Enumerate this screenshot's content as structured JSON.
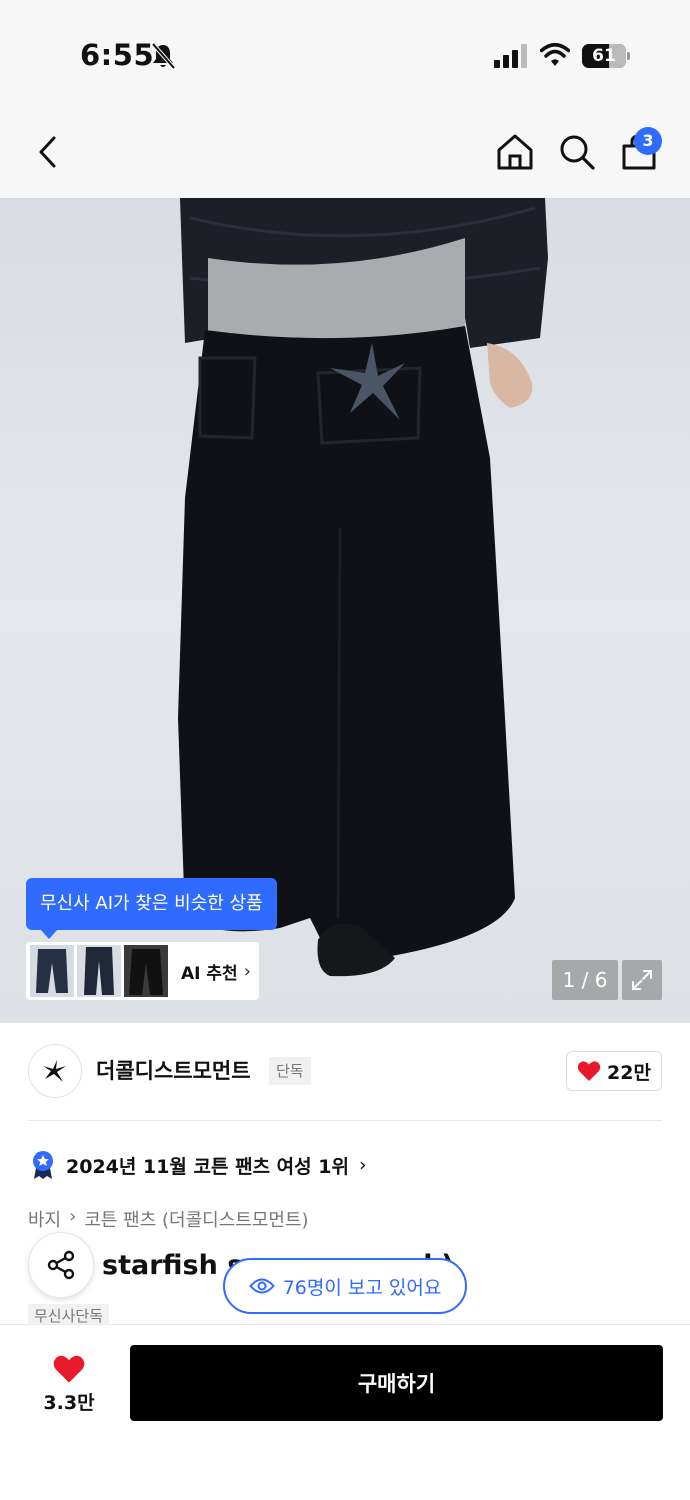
{
  "status_bar": {
    "time": "6:55",
    "battery": "61",
    "battery_level": 0.61
  },
  "nav": {
    "cart_count": "3"
  },
  "gallery": {
    "ai_tooltip": "무신사 AI가 찾은 비슷한 상품",
    "ai_label": "AI 추천",
    "page_indicator": "1 / 6"
  },
  "brand": {
    "name": "더콜디스트모먼트",
    "tag": "단독",
    "likes": "22만"
  },
  "ranking": {
    "text": "2024년 11월 코튼 팬츠 여성 1위"
  },
  "breadcrumb": {
    "category": "바지",
    "subcategory": "코튼 팬츠 (더콜디스트모먼트)"
  },
  "product": {
    "title": "starfish s",
    "title_end": "k)",
    "viewers": "76명이 보고 있어요",
    "exclusive_tag": "무신사단독"
  },
  "bottom_bar": {
    "wish_count": "3.3만",
    "buy_label": "구매하기"
  },
  "colors": {
    "accent": "#2f6bff",
    "heart": "#e8192c",
    "buy_button": "#000000"
  }
}
